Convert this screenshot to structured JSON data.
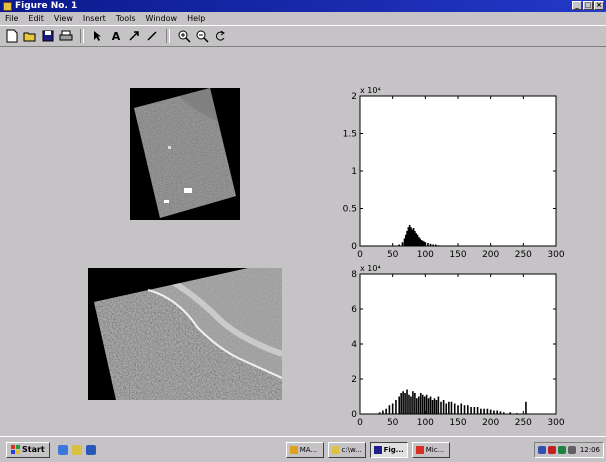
{
  "window": {
    "title": "Figure No. 1"
  },
  "menu": [
    "File",
    "Edit",
    "View",
    "Insert",
    "Tools",
    "Window",
    "Help"
  ],
  "toolbar": {
    "icons": [
      "new-file-icon",
      "open-file-icon",
      "save-icon",
      "print-icon",
      "select-arrow-icon",
      "text-tool-icon",
      "arrow-tool-icon",
      "line-tool-icon",
      "zoom-in-icon",
      "zoom-out-icon",
      "rotate-3d-icon"
    ]
  },
  "chart_data": [
    {
      "type": "bar",
      "title": "",
      "exponent_label": "x 10⁴",
      "xlim": [
        0,
        300
      ],
      "ylim": [
        0,
        2
      ],
      "xticks": [
        "0",
        "50",
        "100",
        "150",
        "200",
        "250",
        "300"
      ],
      "yticks": [
        "0",
        "0.5",
        "1",
        "1.5",
        "2"
      ],
      "x": [
        60,
        65,
        68,
        70,
        72,
        74,
        76,
        78,
        80,
        82,
        84,
        86,
        88,
        90,
        92,
        94,
        96,
        98,
        100,
        104,
        108,
        112,
        116,
        120
      ],
      "values": [
        0.02,
        0.05,
        0.1,
        0.15,
        0.2,
        0.25,
        0.28,
        0.25,
        0.22,
        0.24,
        0.2,
        0.17,
        0.15,
        0.12,
        0.1,
        0.08,
        0.07,
        0.06,
        0.05,
        0.04,
        0.03,
        0.02,
        0.02,
        0.01
      ]
    },
    {
      "type": "bar",
      "title": "",
      "exponent_label": "x 10⁴",
      "xlim": [
        0,
        300
      ],
      "ylim": [
        0,
        8
      ],
      "xticks": [
        "0",
        "50",
        "100",
        "150",
        "200",
        "250",
        "300"
      ],
      "yticks": [
        "0",
        "2",
        "4",
        "6",
        "8"
      ],
      "x": [
        30,
        35,
        40,
        45,
        50,
        55,
        60,
        63,
        66,
        69,
        72,
        75,
        78,
        81,
        84,
        87,
        90,
        93,
        96,
        99,
        102,
        105,
        108,
        111,
        114,
        117,
        120,
        124,
        128,
        132,
        136,
        140,
        145,
        150,
        155,
        160,
        165,
        170,
        175,
        180,
        185,
        190,
        195,
        200,
        205,
        210,
        215,
        220,
        230,
        240,
        254
      ],
      "values": [
        0.1,
        0.2,
        0.3,
        0.5,
        0.6,
        0.8,
        1.0,
        1.2,
        1.3,
        1.2,
        1.4,
        1.1,
        1.0,
        1.3,
        1.2,
        0.9,
        1.0,
        1.2,
        1.1,
        1.0,
        1.1,
        0.9,
        1.0,
        0.8,
        0.9,
        0.8,
        1.0,
        0.7,
        0.8,
        0.6,
        0.7,
        0.7,
        0.6,
        0.5,
        0.6,
        0.5,
        0.5,
        0.4,
        0.4,
        0.4,
        0.3,
        0.3,
        0.3,
        0.25,
        0.2,
        0.2,
        0.15,
        0.1,
        0.1,
        0.05,
        0.7
      ]
    }
  ],
  "taskbar": {
    "start_label": "Start",
    "tasks": [
      "MA...",
      "c:\\w...",
      "Fig...",
      "Mic..."
    ],
    "clock": "12:06"
  },
  "colors": {
    "titlebar": "#0a1a8c",
    "face": "#c6c3c6",
    "bar": "#000000"
  }
}
